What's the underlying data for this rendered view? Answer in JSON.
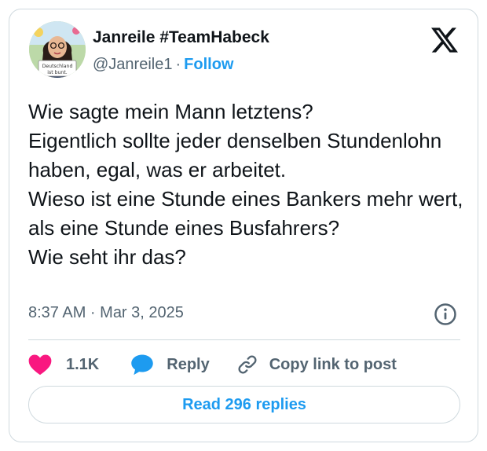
{
  "author": {
    "display_name": "Janreile #TeamHabeck",
    "handle": "@Janreile1",
    "separator": "·",
    "follow_label": "Follow",
    "avatar_sign_text": "Deutschland ist bunt."
  },
  "tweet": {
    "text": "Wie sagte mein Mann letztens?\nEigentlich sollte jeder denselben Stundenlohn haben, egal, was er arbeitet.\nWieso ist eine Stunde eines Bankers mehr wert, als eine Stunde eines Busfahrers?\nWie seht ihr das?",
    "timestamp": "8:37 AM · Mar 3, 2025"
  },
  "actions": {
    "like_count": "1.1K",
    "reply_label": "Reply",
    "copy_link_label": "Copy link to post",
    "read_replies_label": "Read 296 replies"
  },
  "icons": {
    "brand": "x-logo-icon",
    "info": "info-icon",
    "like": "heart-icon",
    "reply": "speech-bubble-icon",
    "copy": "link-icon"
  },
  "colors": {
    "accent": "#1d9bf0",
    "heart": "#f91880",
    "text": "#0f1419",
    "muted": "#536471",
    "border": "#cfd9de"
  }
}
